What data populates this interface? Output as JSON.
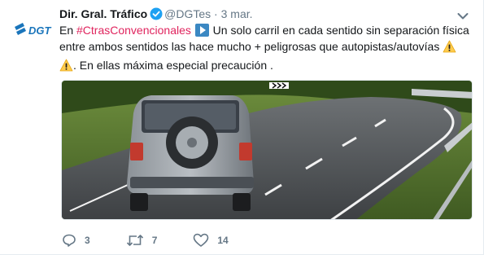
{
  "tweet": {
    "author_name": "Dir. Gral. Tráfico",
    "handle": "@DGTes",
    "separator": "·",
    "date": "3 mar.",
    "avatar_text": "DGT",
    "text": {
      "part1": "En ",
      "hashtag": "#CtrasConvencionales",
      "part2": " Un solo carril en cada sentido sin separación física entre ambos sentidos las hace mucho + peligrosas que autopistas/autovías ",
      "part3": ". En ellas máxima especial precaución ."
    },
    "icons": {
      "verified": "verified-badge-icon",
      "play": "play-button-emoji",
      "warning": "warning-emoji",
      "caret": "chevron-down-icon",
      "reply": "reply-icon",
      "retweet": "retweet-icon",
      "like": "heart-icon"
    },
    "actions": {
      "reply_count": "3",
      "retweet_count": "7",
      "like_count": "14"
    },
    "colors": {
      "hashtag": "#e0245e",
      "verified": "#1da1f2",
      "brand": "#1a75bb",
      "muted": "#657786"
    }
  }
}
